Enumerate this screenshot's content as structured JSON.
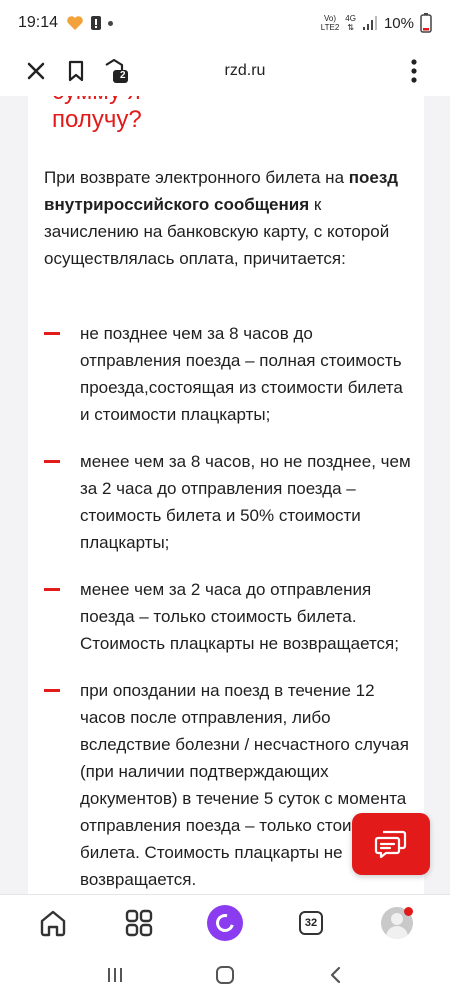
{
  "status_bar": {
    "time": "19:14",
    "network_top": "Vo)",
    "network_bottom": "LTE2",
    "network_type": "4G",
    "battery": "10%"
  },
  "browser": {
    "url": "rzd.ru",
    "tabs_badge": "2"
  },
  "section": {
    "heading_line": "получу?",
    "heading_clipped": "сумму я"
  },
  "content": {
    "intro_part1": "При возврате электронного билета на ",
    "intro_bold": "поезд внутрироссийского сообщения",
    "intro_part2": " к зачислению на банковскую карту, с которой осуществлялась оплата, причитается:",
    "items": [
      "не позднее чем за 8 часов до отправления поезда – полная стоимость проезда,состоящая из стоимости билета и стоимости плацкарты;",
      "менее чем за 8 часов, но не позднее, чем за 2 часа до отправления поезда – стоимость билета и 50% стоимости плацкарты;",
      "менее чем за 2 часа до отправления поезда – только стоимость билета. Стоимость плацкарты не возвращается;",
      "при опоздании на поезд в течение 12 часов после отправления, либо вследствие болезни / несчастного случая (при наличии подтверждающих документов) в течение 5 суток с момента отправления поезда – только стоимость билета. Стоимость плацкарты не возвращается."
    ]
  },
  "bottom_nav": {
    "tabs_count": "32"
  },
  "colors": {
    "accent": "#e21a1a",
    "alice": "#8c3cf0",
    "page_bg": "#f3f3f5"
  }
}
